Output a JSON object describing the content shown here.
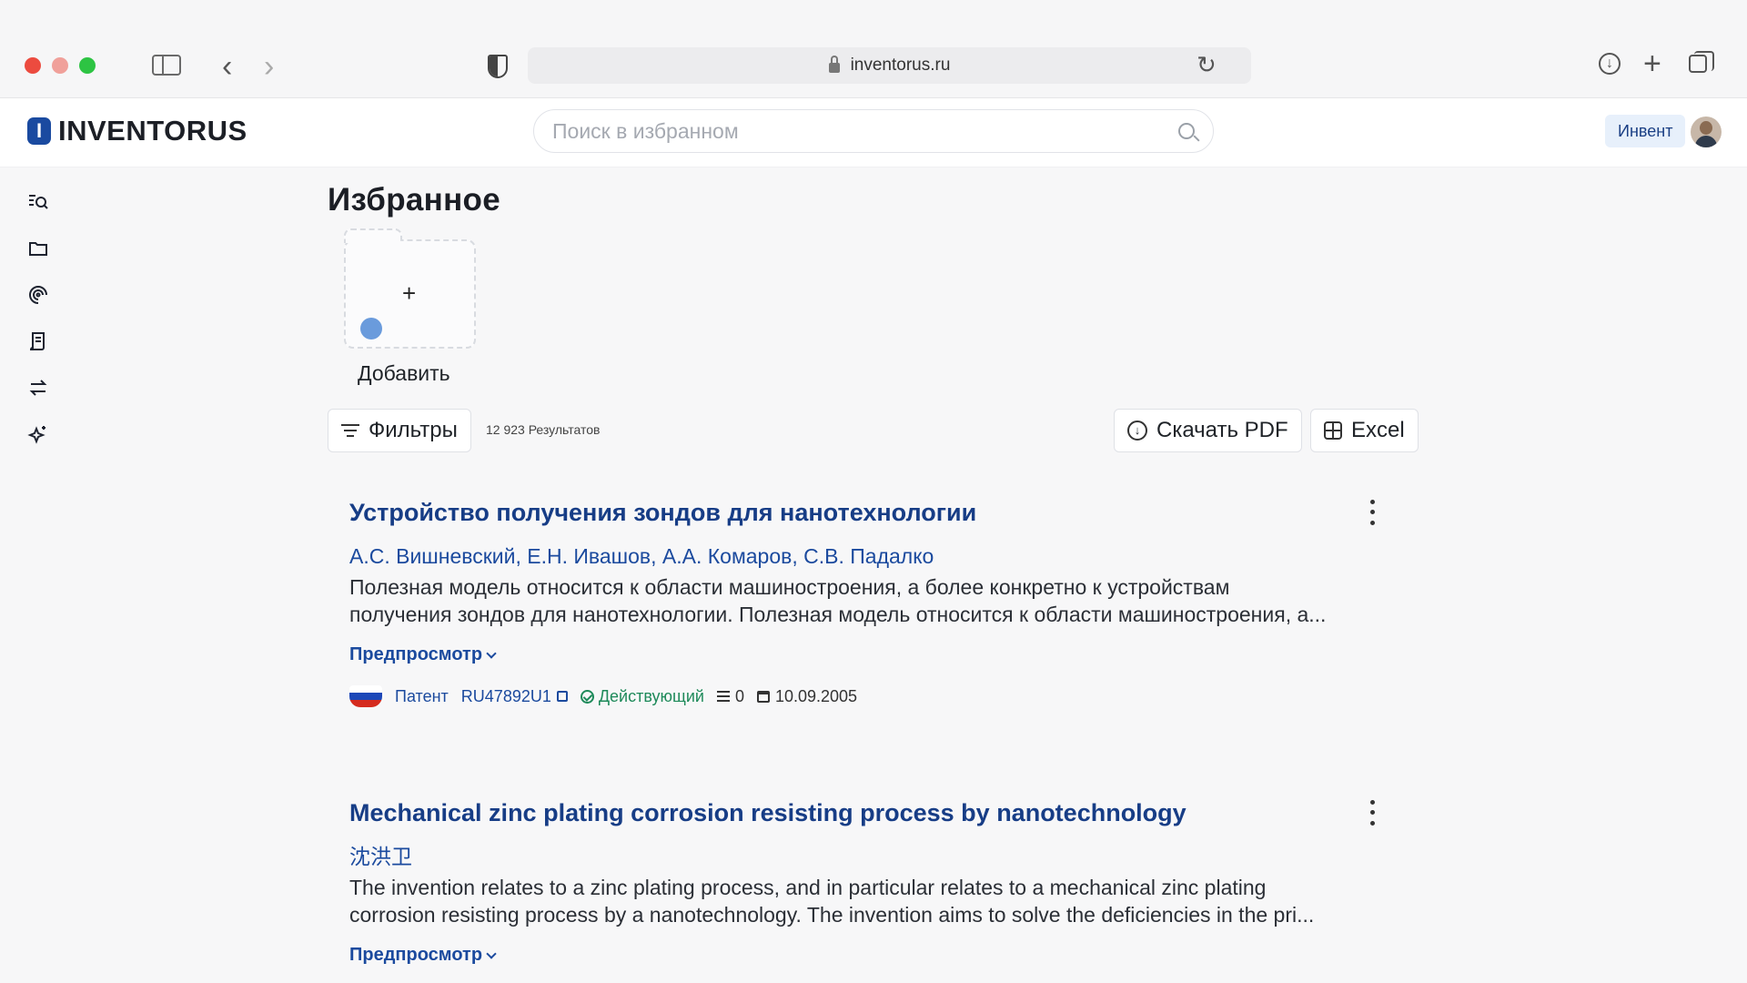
{
  "browser": {
    "url": "inventorus.ru"
  },
  "header": {
    "logo_mark": "I",
    "logo_text": "INVENTORUS",
    "search_placeholder": "Поиск в избранном",
    "user_name": "Инвент"
  },
  "sidebar": {
    "items": [
      {
        "icon": "search-list-icon"
      },
      {
        "icon": "folder-icon"
      },
      {
        "icon": "spiral-icon"
      },
      {
        "icon": "document-scroll-icon"
      },
      {
        "icon": "swap-arrows-icon"
      },
      {
        "icon": "sparkles-icon"
      }
    ]
  },
  "main": {
    "title": "Избранное",
    "add_folder": {
      "plus": "+",
      "label": "Добавить"
    },
    "toolbar": {
      "filters_label": "Фильтры",
      "results_count": "12 923 Результатов",
      "pdf_label": "Скачать PDF",
      "excel_label": "Excel"
    },
    "results": [
      {
        "title": "Устройство получения зондов для нанотехнологии",
        "authors": "А.С. Вишневский, Е.Н. Ивашов, А.А. Комаров, С.В. Падалко",
        "abstract_line1": "Полезная модель относится к области машиностроения, а более конкретно к устройствам",
        "abstract_line2": "получения зондов для нанотехнологии. Полезная модель относится к области машиностроения, а...",
        "preview_label": "Предпросмотр",
        "type": "Патент",
        "number": "RU47892U1",
        "status": "Действующий",
        "claims": "0",
        "date": "10.09.2005"
      },
      {
        "title": "Mechanical zinc plating corrosion resisting process by nanotechnology",
        "authors": "沈洪卫",
        "abstract_line1": "The invention relates to a zinc plating process, and in particular relates to a mechanical zinc plating",
        "abstract_line2": "corrosion resisting process by a nanotechnology. The invention aims to solve the deficiencies in the pri...",
        "preview_label": "Предпросмотр"
      }
    ]
  },
  "colors": {
    "brand": "#1a4aa0",
    "link": "#173d86",
    "status_active": "#1e8a5a",
    "folder_dot": "#6a9bdc"
  }
}
